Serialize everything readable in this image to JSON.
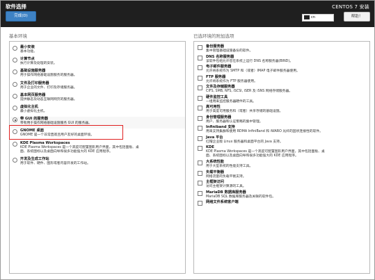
{
  "header": {
    "title": "软件选择",
    "done_label": "完成(D)",
    "product": "CENTOS 7 安装",
    "keyboard": "cn",
    "help_label": "帮助！"
  },
  "left": {
    "heading": "基本环境",
    "items": [
      {
        "name": "最小安装",
        "desc": "基本功能。",
        "selected": false
      },
      {
        "name": "计算节点",
        "desc": "执行计算及处理的安装。",
        "selected": false
      },
      {
        "name": "基础设施服务器",
        "desc": "用于操作网络基础设施服务的服务器。",
        "selected": false
      },
      {
        "name": "文件及打印服务器",
        "desc": "用于企业的文件、打印及存储服务器。",
        "selected": false
      },
      {
        "name": "基本网页服务器",
        "desc": "提供静态及动态互联网网页的服务器。",
        "selected": false
      },
      {
        "name": "虚拟化主机",
        "desc": "最小虚拟化主机。",
        "selected": false
      },
      {
        "name": "带 GUI 的服务器",
        "desc": "带有用于操作网络基础设施服务 GUI 的服务器。",
        "selected": true
      },
      {
        "name": "GNOME 桌面",
        "desc": "GNOME 是一个非常直观且用户友好的桌面环境。",
        "selected": false
      },
      {
        "name": "KDE Plasma Workspaces",
        "desc": "KDE Plasma Workspaces 是一个高度可配置图形用户界面，其中包括面板、桌面、系统图标以及桌面向导和很多功能强大的 KDE 应用程序。",
        "desc_lines": [
          "KDE Plasma Workspaces 是一个高度可配置图形用户界面，其中包括面板、桌",
          "面、系统图标以及桌面向导和很多功能强大的 KDE 应用程序。"
        ],
        "selected": false
      },
      {
        "name": "开发及生成工作站",
        "desc": "用于软件、硬件、图形或者内容开发的工作站。",
        "selected": false
      }
    ]
  },
  "right": {
    "heading": "已选环境的附加选项",
    "items": [
      {
        "name": "备份服务器",
        "desc": "集中管理基础设施备份的软件。"
      },
      {
        "name": "DNS 名称服务器",
        "desc": "该软件包组允许您在系统上运行 DNS 名称服务器(BIND)。"
      },
      {
        "name": "电子邮件服务器",
        "desc": "允许将系统作为 SMTP 和（或者）IMAP 电子邮件服务器使用。"
      },
      {
        "name": "FTP 服务器",
        "desc": "允许将系统作为 FTP 服务器使用。"
      },
      {
        "name": "文件及存储服务器",
        "desc": "CIFS, SMB, NFS, iSCSI, iSER 及 iSNS 网络存储服务器。"
      },
      {
        "name": "硬件监控工具",
        "desc": "一组用来监控服务器硬件的工具。"
      },
      {
        "name": "高可用性",
        "desc": "用于高度可用服务和（或者）共享存储的基础设施。"
      },
      {
        "name": "身份管理服务器",
        "desc": "用户、服务器和认证策略的集中管理。"
      },
      {
        "name": "Infiniband 支持",
        "desc": "用来支持集群和使用 RDMA InfiniBand 和 iWARO 光纤的固状连接性的软件。"
      },
      {
        "name": "Java 平台",
        "desc": "红帽企业版 Linux 服务器和桌面平台的 Java 支持。"
      },
      {
        "name": "KDE",
        "desc_lines": [
          "KDE Plasma Workspaces 是一个高度可配置图形用户界面，其中包括面板、桌",
          "面、系统图标以及桌面向导和很多功能强大的 KDE 应用程序。"
        ],
        "desc": "KDE Plasma Workspaces 是一个高度可配置图形用户界面，其中包括面板、桌面、系统图标以及桌面向导和很多功能强大的 KDE 应用程序。"
      },
      {
        "name": "大系统性能",
        "desc": "用于大型系统的性能支持工具。"
      },
      {
        "name": "负载平衡器",
        "desc": "网络流量的负载平衡支持。"
      },
      {
        "name": "主框架访问",
        "desc": "访问主框架计算源的工具。"
      },
      {
        "name": "MariaDB 数据库服务器",
        "desc": "MariaDB SQL 数据库服务器及关联的软件包。"
      },
      {
        "name": "网络文件系统客户端",
        "desc": ""
      }
    ]
  }
}
